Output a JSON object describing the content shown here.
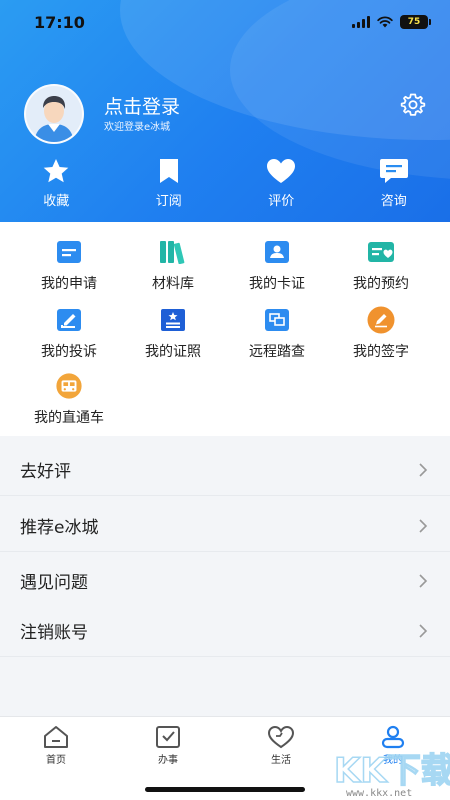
{
  "status_bar": {
    "time": "17:10",
    "battery": "75"
  },
  "profile": {
    "login_title": "点击登录",
    "login_subtitle": "欢迎登录e冰城"
  },
  "quick_actions": [
    {
      "label": "收藏",
      "icon": "star-icon"
    },
    {
      "label": "订阅",
      "icon": "bookmark-icon"
    },
    {
      "label": "评价",
      "icon": "heart-icon"
    },
    {
      "label": "咨询",
      "icon": "chat-icon"
    }
  ],
  "services": [
    {
      "label": "我的申请",
      "icon": "application-icon",
      "color": "#2d8cf0"
    },
    {
      "label": "材料库",
      "icon": "books-icon",
      "color": "#22b5a6"
    },
    {
      "label": "我的卡证",
      "icon": "id-card-icon",
      "color": "#2d8cf0"
    },
    {
      "label": "我的预约",
      "icon": "appointment-icon",
      "color": "#22b5a6"
    },
    {
      "label": "我的投诉",
      "icon": "edit-icon",
      "color": "#2d8cf0"
    },
    {
      "label": "我的证照",
      "icon": "certificate-icon",
      "color": "#1e5fd6"
    },
    {
      "label": "远程踏查",
      "icon": "remote-inspect-icon",
      "color": "#2d8cf0"
    },
    {
      "label": "我的签字",
      "icon": "signature-icon",
      "color": "#f0922e"
    },
    {
      "label": "我的直通车",
      "icon": "express-icon",
      "color": "#f2a53a"
    }
  ],
  "menu": [
    {
      "label": "去好评"
    },
    {
      "label": "推荐e冰城"
    },
    {
      "label": "遇见问题"
    },
    {
      "label": "注销账号"
    }
  ],
  "tabs": [
    {
      "label": "首页",
      "icon": "home-icon",
      "active": false
    },
    {
      "label": "办事",
      "icon": "tasks-icon",
      "active": false
    },
    {
      "label": "生活",
      "icon": "life-heart-icon",
      "active": false
    },
    {
      "label": "我的",
      "icon": "profile-icon",
      "active": true
    }
  ],
  "watermark": {
    "logo": "KK下载",
    "url": "www.kkx.net"
  },
  "colors": {
    "primary": "#1f7ff0",
    "teal": "#22b5a6",
    "orange": "#f0922e"
  }
}
